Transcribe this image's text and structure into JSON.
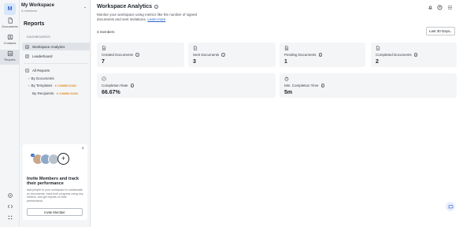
{
  "rail": {
    "avatar_initial": "M",
    "items": [
      {
        "label": "Documents",
        "icon": "document-icon"
      },
      {
        "label": "Contacts",
        "icon": "contacts-icon"
      },
      {
        "label": "Reports",
        "icon": "reports-icon"
      }
    ],
    "bottom_icons": [
      "settings-icon",
      "code-icon",
      "grid-icon"
    ]
  },
  "workspace": {
    "name": "My Workspace",
    "members": "3 members"
  },
  "sidebar": {
    "title": "Reports",
    "section_label": "DASHBOARDS",
    "items": [
      {
        "label": "Workspace Analytics",
        "icon": "analytics-icon"
      },
      {
        "label": "Leaderboard",
        "icon": "leaderboard-icon"
      }
    ],
    "all_reports_label": "All Reports",
    "sub_items": [
      {
        "label": "By Documents",
        "badge": ""
      },
      {
        "label": "By Templates",
        "badge": "COMING SOON"
      },
      {
        "label": "By Recipients",
        "badge": "COMING SOON"
      }
    ]
  },
  "invite": {
    "badge": "+3",
    "title": "Invite Members and track their performance",
    "text": "Add people to your workspace to collaborate on documents, track their progress using key metrics, and get reports on their performance.",
    "button": "Invite Member"
  },
  "main": {
    "title": "Workspace Analytics",
    "description": "Monitor your workspace using metrics like the number of signed documents and sent invitations.",
    "learn_more": "Learn more",
    "members_count": "3 members",
    "range": "Last 30 Days",
    "cards": [
      {
        "label": "Created Documents",
        "value": "7",
        "icon": "document-plus-icon"
      },
      {
        "label": "Sent Documents",
        "value": "3",
        "icon": "send-icon"
      },
      {
        "label": "Pending Documents",
        "value": "1",
        "icon": "hourglass-icon"
      },
      {
        "label": "Completed Documents",
        "value": "2",
        "icon": "document-check-icon"
      },
      {
        "label": "Completion Rate",
        "value": "66.67%",
        "icon": "check-circle-icon"
      },
      {
        "label": "Min. Completion Time",
        "value": "5m",
        "icon": "timer-icon"
      }
    ]
  },
  "colors": {
    "accent": "#2a63c9",
    "coming_soon": "#e08a1c",
    "card_bg": "#f4f5f7"
  }
}
